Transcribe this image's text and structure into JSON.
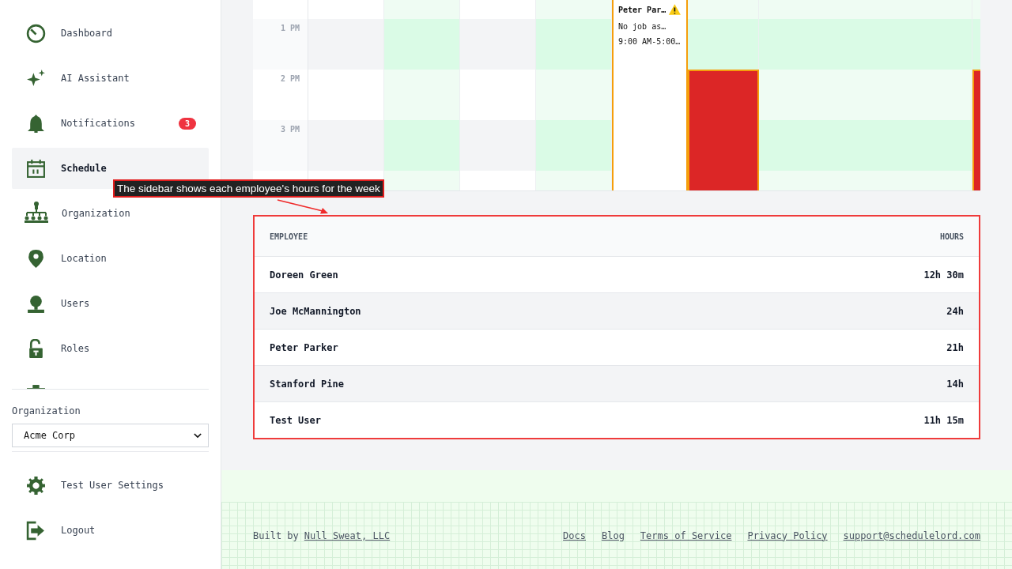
{
  "sidebar": {
    "nav": [
      {
        "label": "Dashboard",
        "selected": false
      },
      {
        "label": "AI Assistant",
        "selected": false
      },
      {
        "label": "Notifications",
        "selected": false,
        "badge": "3"
      },
      {
        "label": "Schedule",
        "selected": true
      },
      {
        "label": "Organization",
        "selected": false
      },
      {
        "label": "Location",
        "selected": false
      },
      {
        "label": "Users",
        "selected": false
      },
      {
        "label": "Roles",
        "selected": false
      }
    ],
    "org_label": "Organization",
    "org_select": "Acme Corp",
    "footer_nav": [
      {
        "label": "Test User Settings"
      },
      {
        "label": "Logout"
      }
    ]
  },
  "calendar": {
    "times": [
      "1 PM",
      "2 PM",
      "3 PM"
    ],
    "columns": [
      {
        "kind": "plain"
      },
      {
        "kind": "shaded"
      },
      {
        "kind": "plain"
      },
      {
        "kind": "shaded"
      },
      {
        "kind": "event"
      },
      {
        "kind": "shaded"
      }
    ],
    "events": [
      {
        "kind": "shift",
        "title": "Peter Par…",
        "warning": true,
        "lines": [
          "No job as…",
          "9:00 AM-5:00…"
        ]
      },
      {
        "kind": "block"
      },
      {
        "kind": "block"
      }
    ]
  },
  "annotation": {
    "text": "The sidebar shows each employee's hours for the week"
  },
  "hours_table": {
    "columns": [
      "EMPLOYEE",
      "HOURS"
    ],
    "rows": [
      {
        "name": "Doreen Green",
        "hours": "12h 30m"
      },
      {
        "name": "Joe McMannington",
        "hours": "24h"
      },
      {
        "name": "Peter Parker",
        "hours": "21h"
      },
      {
        "name": "Stanford Pine",
        "hours": "14h"
      },
      {
        "name": "Test User",
        "hours": "11h 15m"
      }
    ]
  },
  "footer": {
    "built_by": "Built by",
    "company": "Null Sweat, LLC",
    "links": [
      "Docs",
      "Blog",
      "Terms of Service",
      "Privacy Policy",
      "support@schedulelord.com"
    ]
  }
}
